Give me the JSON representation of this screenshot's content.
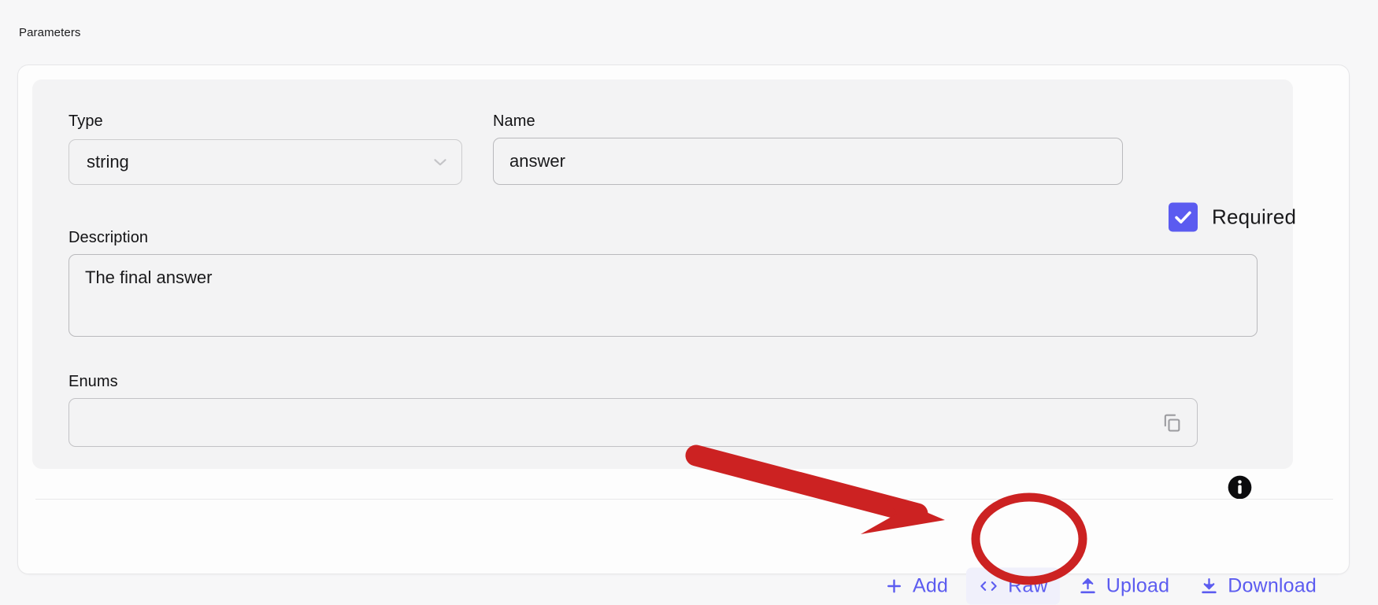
{
  "section": {
    "label": "Parameters"
  },
  "colors": {
    "accent": "#5c5cf0",
    "checkbox_fill": "#5b5bf0",
    "annotation": "#cc2222",
    "panel_bg": "#f3f3f4",
    "card_bg": "#fdfdfd",
    "page_bg": "#f7f7f8"
  },
  "parameter": {
    "type": {
      "label": "Type",
      "value": "string",
      "icon": "chevron-down-icon"
    },
    "name": {
      "label": "Name",
      "value": "answer",
      "placeholder": ""
    },
    "required": {
      "label": "Required",
      "checked": true
    },
    "description": {
      "label": "Description",
      "value": "The final answer",
      "placeholder": ""
    },
    "enums": {
      "label": "Enums",
      "value": "",
      "placeholder": "",
      "copy_icon": "copy-icon"
    },
    "info": {
      "icon": "info-icon"
    }
  },
  "actions": [
    {
      "label": "Add",
      "icon": "plus-icon",
      "hovered": false
    },
    {
      "label": "Raw",
      "icon": "code-icon",
      "hovered": true
    },
    {
      "label": "Upload",
      "icon": "upload-icon",
      "hovered": false
    },
    {
      "label": "Download",
      "icon": "download-icon",
      "hovered": false
    }
  ],
  "annotation": {
    "arrow": "red-arrow-pointing-to-raw-button",
    "ellipse": "red-ellipse-highlighting-raw-button"
  }
}
